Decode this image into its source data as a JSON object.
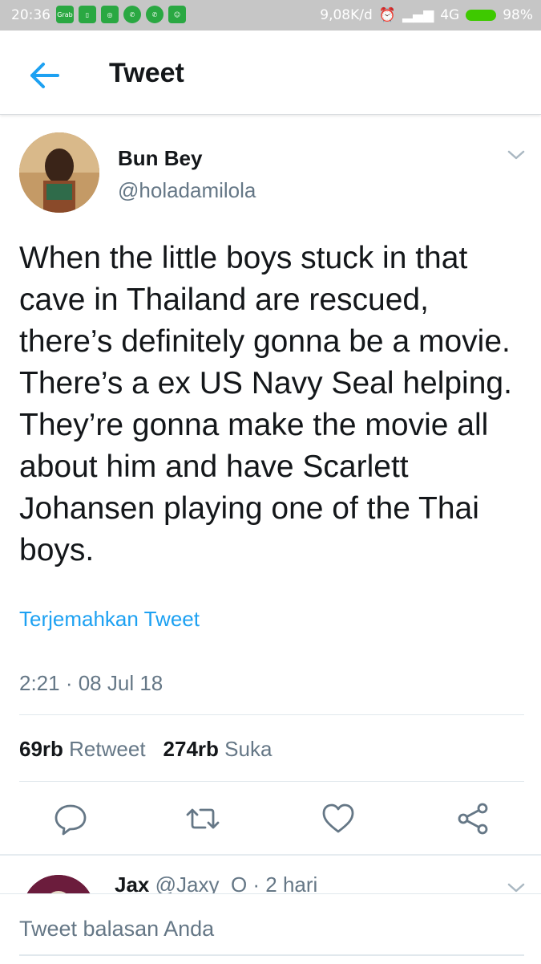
{
  "status_bar": {
    "time": "20:36",
    "network_speed": "9,08K/d",
    "network_type": "4G",
    "battery": "98%",
    "app_icons": [
      "grab-icon",
      "app-icon",
      "app-icon",
      "whatsapp-icon",
      "whatsapp-icon",
      "app-icon"
    ],
    "grab_label": "Grab"
  },
  "appbar": {
    "title": "Tweet",
    "accent": "#1da1f2"
  },
  "tweet": {
    "author_name": "Bun Bey",
    "author_handle": "@holadamilola",
    "text": "When the little boys stuck in that cave in Thailand are rescued, there’s definitely gonna be a movie. There’s a ex US Navy Seal helping. They’re gonna make the movie all about him and have Scarlett Johansen playing one of the Thai boys.",
    "translate_label": "Terjemahkan Tweet",
    "timestamp": "2:21 · 08 Jul 18",
    "retweet_count": "69rb",
    "retweet_label": "Retweet",
    "like_count": "274rb",
    "like_label": "Suka"
  },
  "reply_preview": {
    "name": "Jax",
    "handle": "@Jaxy_O",
    "time": "· 2 hari"
  },
  "compose": {
    "placeholder": "Tweet balasan Anda"
  }
}
